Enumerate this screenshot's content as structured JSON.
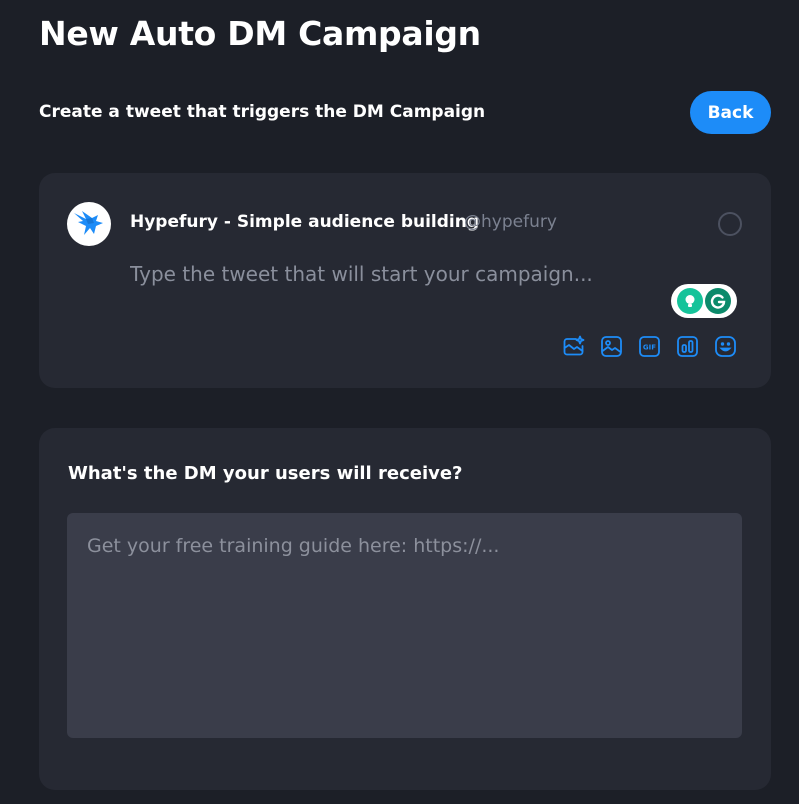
{
  "header": {
    "title": "New Auto DM Campaign",
    "subtitle": "Create a tweet that triggers the DM Campaign",
    "back_label": "Back"
  },
  "tweet_card": {
    "account_name": "Hypefury - Simple audience building",
    "account_handle": "@hypefury",
    "placeholder": "Type the tweet that will start your campaign...",
    "toolbar_icons": [
      "media-sparkle-icon",
      "image-icon",
      "gif-icon",
      "poll-icon",
      "emoji-icon"
    ],
    "gif_label": "GIF"
  },
  "dm_card": {
    "label": "What's the DM your users will receive?",
    "placeholder": "Get your free training guide here: https://..."
  },
  "colors": {
    "background": "#1c1f27",
    "card": "#262933",
    "accent": "#1d8cf8",
    "input": "#3a3d4a",
    "grammarly": "#15c39a"
  }
}
